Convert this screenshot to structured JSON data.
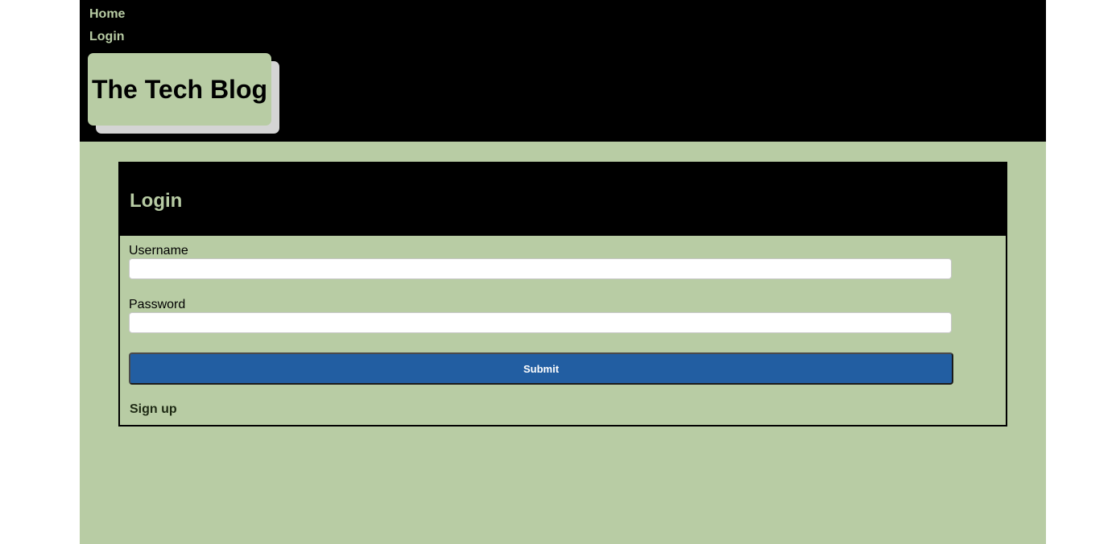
{
  "nav": {
    "home_label": "Home",
    "login_label": "Login"
  },
  "header": {
    "site_title": "The Tech Blog"
  },
  "login_card": {
    "title": "Login",
    "username_label": "Username",
    "username_value": "",
    "password_label": "Password",
    "password_value": "",
    "submit_label": "Submit",
    "signup_label": "Sign up"
  },
  "colors": {
    "page_background": "#b8cca4",
    "header_background": "#000000",
    "accent_text": "#b8cca4",
    "submit_button": "#225ea2",
    "logo_shadow": "#d4d4d4"
  }
}
